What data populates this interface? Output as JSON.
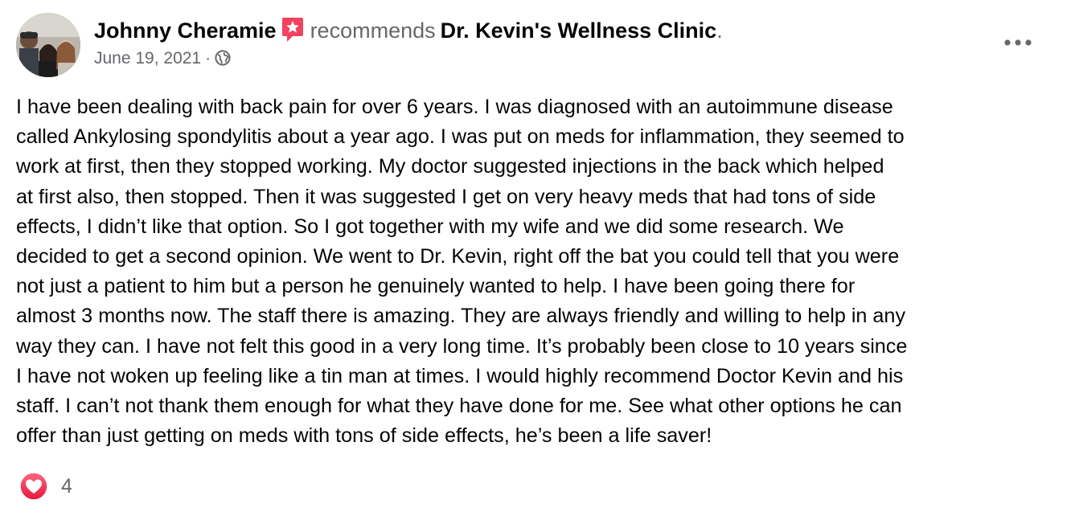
{
  "post": {
    "author": "Johnny Cheramie",
    "action": "recommends",
    "page_name": "Dr. Kevin's Wellness Clinic",
    "period": ".",
    "date": "June 19, 2021",
    "separator": "·",
    "audience_icon": "globe-icon",
    "badge_icon": "recommendation-star-icon",
    "more_icon": "more-options-icon",
    "text": "I have been dealing with back pain for over 6 years.  I was diagnosed with an autoimmune disease\ncalled Ankylosing spondylitis about a year ago. I was put on meds for inflammation, they seemed to\nwork at first, then they stopped working. My doctor suggested injections in the back which helped\nat first also, then stopped.  Then it was suggested I get on very heavy meds that had tons of side\neffects, I didn’t like that option.  So I got together with my wife and we did some research. We\ndecided to get a second opinion. We went to Dr. Kevin, right off the bat you could tell that you were\nnot just a patient to him but a person he genuinely wanted to help. I have been going there for\nalmost 3 months now. The staff there is amazing. They are always friendly and willing to help in any\nway they can. I have not felt this good in a very long time.  It’s probably been close to 10 years since\nI have not woken up feeling like a tin man at times. I would highly recommend Doctor Kevin and his\nstaff. I can’t not thank them enough for what they have done for me.  See what other options he can\noffer than just getting on meds with tons of side effects, he’s been a life saver!"
  },
  "reactions": {
    "icon": "love-reaction-icon",
    "count": "4"
  },
  "colors": {
    "text": "#050505",
    "secondary": "#65676b",
    "badge": "#f3425f",
    "love": "#f33e58"
  }
}
